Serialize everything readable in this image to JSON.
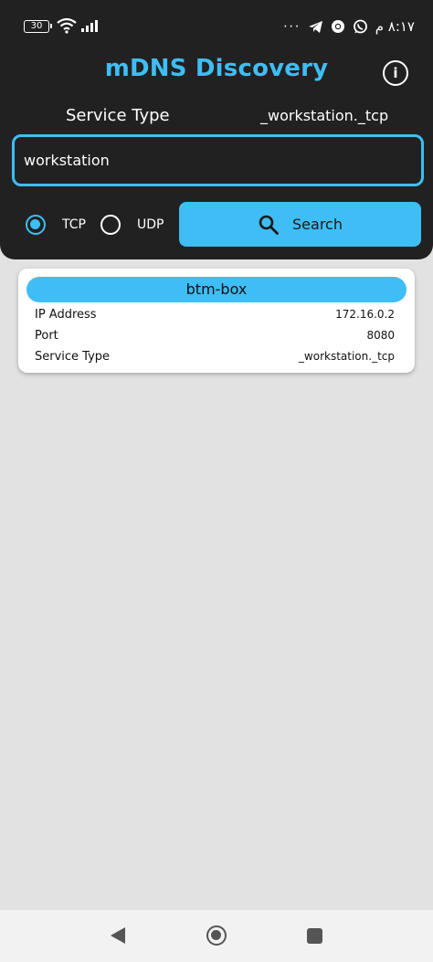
{
  "status_bar": {
    "battery": "30",
    "time": "٨:١٧ م",
    "more_icon": "dots-icon",
    "icons": [
      "telegram-icon",
      "chrome-icon",
      "whatsapp-icon"
    ]
  },
  "app": {
    "title": "mDNS Discovery",
    "info_icon": "info-icon"
  },
  "service_type": {
    "label": "Service Type",
    "value": "_workstation._tcp"
  },
  "search": {
    "input_value": "workstation",
    "protocols": [
      {
        "label": "TCP",
        "selected": true
      },
      {
        "label": "UDP",
        "selected": false
      }
    ],
    "button_label": "Search"
  },
  "results": [
    {
      "name": "btm-box",
      "rows": [
        {
          "label": "IP Address",
          "value": "172.16.0.2"
        },
        {
          "label": "Port",
          "value": "8080"
        },
        {
          "label": "Service Type",
          "value": "_workstation._tcp"
        }
      ]
    }
  ],
  "colors": {
    "accent": "#3fbdf5",
    "header_bg": "#212121",
    "body_bg": "#e2e2e2"
  }
}
